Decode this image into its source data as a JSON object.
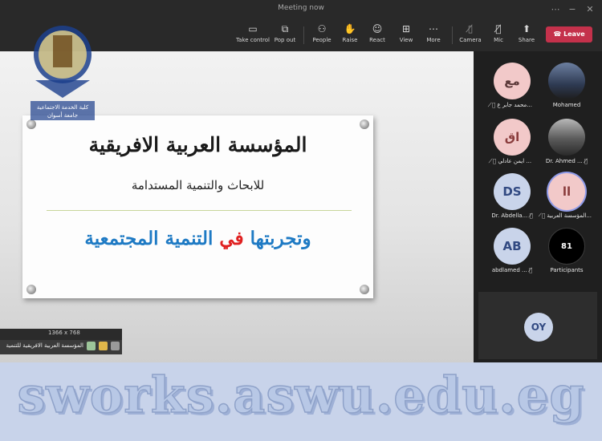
{
  "window": {
    "title": "Meeting now"
  },
  "toolbar": {
    "buttons": [
      {
        "label": "Take control",
        "icon": "take-control-icon"
      },
      {
        "label": "Pop out",
        "icon": "pop-out-icon"
      },
      {
        "label": "People",
        "icon": "people-icon"
      },
      {
        "label": "Raise",
        "icon": "raise-hand-icon"
      },
      {
        "label": "React",
        "icon": "react-icon"
      },
      {
        "label": "View",
        "icon": "view-icon"
      },
      {
        "label": "More",
        "icon": "more-icon"
      },
      {
        "label": "Camera",
        "icon": "camera-off-icon"
      },
      {
        "label": "Mic",
        "icon": "mic-off-icon"
      },
      {
        "label": "Share",
        "icon": "share-icon"
      }
    ],
    "leave_label": "Leave"
  },
  "slide": {
    "title": "المؤسسة العربية الافريقية",
    "subtitle": "للابحاث والتنمية المستدامة",
    "tagline_part1": "وتجربتها",
    "tagline_highlight": "في",
    "tagline_part2": "التنمية المجتمعية",
    "highlight_color": "#e02020",
    "tagline_color": "#1e7ac4"
  },
  "logo": {
    "line1": "كلية الخدمة الاجتماعية",
    "line2": "جامعة أسوان"
  },
  "mini_window": {
    "size_text": "1366 x 768",
    "caption": "المؤسسة العربية الافريقية للتنمية"
  },
  "participants": [
    {
      "initials": "مع",
      "name": "محمد جابر ع...",
      "avatar_color": "#f2c9c9",
      "text_color": "#5c3a3a",
      "muted": true
    },
    {
      "initials": "",
      "name": "Mohamed",
      "avatar_color": "#6c7fa0",
      "photo": true,
      "muted": false
    },
    {
      "initials": "اق",
      "name": "ايمن عادلي ...",
      "avatar_color": "#f2c9c9",
      "text_color": "#8a3d3d",
      "muted": true
    },
    {
      "initials": "",
      "name": "Dr. Ahmed ...",
      "avatar_color": "#6c6c6c",
      "photo": true,
      "muted": true
    },
    {
      "initials": "DS",
      "name": "Dr. Abdella...",
      "avatar_color": "#c9d4ea",
      "text_color": "#324a82",
      "muted": true
    },
    {
      "initials": "اا",
      "name": "المؤسسة العربية...",
      "avatar_color": "#f2c9c9",
      "text_color": "#8a3d3d",
      "muted": true,
      "speaking": true
    },
    {
      "initials": "AB",
      "name": "abdlamed ...",
      "avatar_color": "#c9d4ea",
      "text_color": "#324a82",
      "muted": true
    },
    {
      "initials": "81",
      "name": "Participants",
      "avatar_color": "#000000",
      "text_color": "#ffffff",
      "muted": false
    }
  ],
  "self_tile": {
    "initials": "OY"
  },
  "banner": {
    "text": "sworks.aswu.edu.eg"
  }
}
